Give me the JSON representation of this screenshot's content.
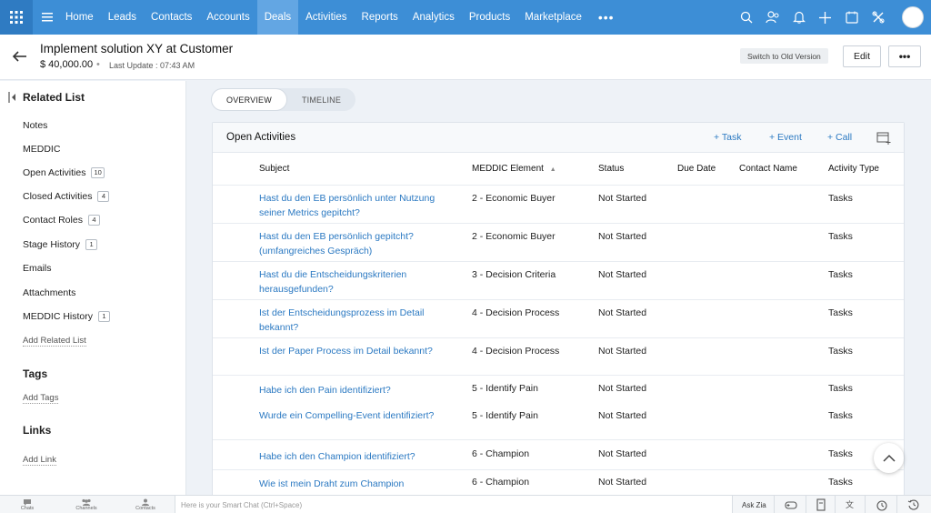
{
  "topnav": {
    "items": [
      "Home",
      "Leads",
      "Contacts",
      "Accounts",
      "Deals",
      "Activities",
      "Reports",
      "Analytics",
      "Products",
      "Marketplace"
    ],
    "active": "Deals",
    "icons": [
      "search-icon",
      "contacts-icon",
      "bell-icon",
      "plus-icon",
      "calendar-icon",
      "settings-tools-icon",
      "avatar"
    ]
  },
  "header": {
    "title": "Implement solution XY at Customer",
    "amount": "$ 40,000.00",
    "separator": "•",
    "last_update": "Last Update : 07:43 AM",
    "switch_label": "Switch to Old Version",
    "edit_label": "Edit",
    "more_label": "•••"
  },
  "sidebar": {
    "related_heading": "Related List",
    "items": [
      {
        "label": "Notes",
        "count": ""
      },
      {
        "label": "MEDDIC",
        "count": ""
      },
      {
        "label": "Open Activities",
        "count": "10"
      },
      {
        "label": "Closed Activities",
        "count": "4"
      },
      {
        "label": "Contact Roles",
        "count": "4"
      },
      {
        "label": "Stage History",
        "count": "1"
      },
      {
        "label": "Emails",
        "count": ""
      },
      {
        "label": "Attachments",
        "count": ""
      },
      {
        "label": "MEDDIC History",
        "count": "1"
      }
    ],
    "add_related": "Add Related List",
    "tags_heading": "Tags",
    "add_tags": "Add Tags",
    "links_heading": "Links",
    "add_link": "Add Link"
  },
  "tabs": [
    "OVERVIEW",
    "TIMELINE"
  ],
  "panel": {
    "title": "Open Activities",
    "actions": [
      "+ Task",
      "+ Event",
      "+ Call"
    ],
    "columns": [
      "Subject",
      "MEDDIC Element",
      "Status",
      "Due Date",
      "Contact Name",
      "Activity Type"
    ],
    "sort_indicator": "▲",
    "rows": [
      {
        "subject": "Hast du den EB persönlich unter Nutzung seiner Metrics gepitcht?",
        "element": "2 - Economic Buyer",
        "status": "Not Started",
        "due": "",
        "contact": "",
        "type": "Tasks"
      },
      {
        "subject": "Hast du den EB persönlich gepitcht? (umfangreiches Gespräch)",
        "element": "2 - Economic Buyer",
        "status": "Not Started",
        "due": "",
        "contact": "",
        "type": "Tasks"
      },
      {
        "subject": "Hast du die Entscheidungskriterien herausgefunden?",
        "element": "3 - Decision Criteria",
        "status": "Not Started",
        "due": "",
        "contact": "",
        "type": "Tasks"
      },
      {
        "subject": "Ist der Entscheidungsprozess im Detail bekannt?",
        "element": "4 - Decision Process",
        "status": "Not Started",
        "due": "",
        "contact": "",
        "type": "Tasks"
      },
      {
        "subject": "Ist der Paper Process im Detail bekannt?",
        "element": "4 - Decision Process",
        "status": "Not Started",
        "due": "",
        "contact": "",
        "type": "Tasks"
      },
      {
        "subject": "Habe ich den Pain identifiziert?",
        "element": "5 - Identify Pain",
        "status": "Not Started",
        "due": "",
        "contact": "",
        "type": "Tasks"
      },
      {
        "subject": "Wurde ein Compelling-Event identifiziert?",
        "element": "5 - Identify Pain",
        "status": "Not Started",
        "due": "",
        "contact": "",
        "type": "Tasks"
      },
      {
        "subject": "Habe ich den Champion identifiziert?",
        "element": "6 - Champion",
        "status": "Not Started",
        "due": "",
        "contact": "",
        "type": "Tasks"
      },
      {
        "subject": "Wie ist mein Draht zum Champion",
        "element": "6 - Champion",
        "status": "Not Started",
        "due": "",
        "contact": "",
        "type": "Tasks"
      }
    ]
  },
  "bottombar": {
    "items": [
      "Chats",
      "Channels",
      "Contacts"
    ],
    "chat_placeholder": "Here is your Smart Chat (Ctrl+Space)",
    "ask_zia": "Ask Zia"
  },
  "colors": {
    "nav_bg": "#3d8ed6",
    "nav_active": "#63a6e3",
    "link": "#2b79c2"
  }
}
